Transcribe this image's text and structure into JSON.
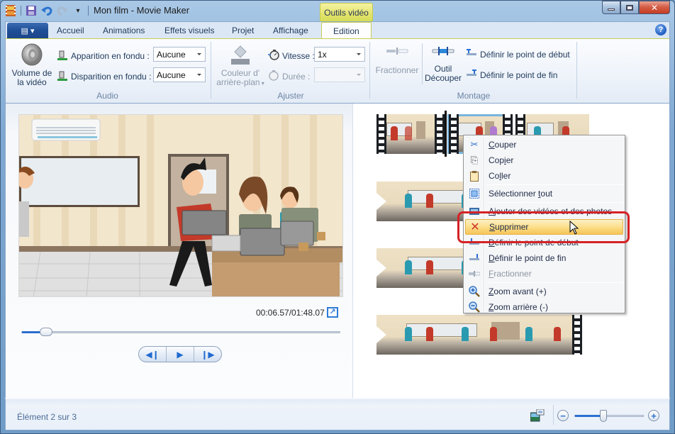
{
  "window": {
    "title": "Mon film - Movie Maker",
    "quick_access": [
      {
        "icon": "moviemaker-app-icon"
      },
      {
        "icon": "save-icon"
      },
      {
        "icon": "undo-icon"
      },
      {
        "icon": "redo-icon"
      },
      {
        "icon": "customize-qat-icon"
      }
    ],
    "controls": {
      "minimize": "—",
      "maximize": "▫",
      "close": "✕"
    }
  },
  "ribbon": {
    "app_menu_label": "▤ ▾",
    "contextual_header": "Outils vidéo",
    "tabs": [
      {
        "label": "Accueil",
        "active": false
      },
      {
        "label": "Animations",
        "active": false
      },
      {
        "label": "Effets visuels",
        "active": false
      },
      {
        "label": "Projet",
        "active": false
      },
      {
        "label": "Affichage",
        "active": false
      },
      {
        "label": "Edition",
        "active": true
      }
    ],
    "help_label": "?",
    "groups": {
      "audio": {
        "label": "Audio",
        "volume_label_1": "Volume de",
        "volume_label_2": "la vidéo",
        "fade_in_label": "Apparition en fondu :",
        "fade_in_value": "Aucune",
        "fade_out_label": "Disparition en fondu :",
        "fade_out_value": "Aucune"
      },
      "ajuster": {
        "label": "Ajuster",
        "bg_color_label_1": "Couleur d'",
        "bg_color_label_2": "arrière-plan",
        "speed_label": "Vitesse :",
        "speed_value": "1x",
        "duration_label": "Durée :",
        "duration_value": ""
      },
      "montage": {
        "label": "Montage",
        "split_label": "Fractionner",
        "trim_label_1": "Outil",
        "trim_label_2": "Découper",
        "set_start_label": "Définir le point de début",
        "set_end_label": "Définir le point de fin"
      }
    }
  },
  "preview": {
    "timecode": "00:06.57/01:48.07",
    "progress_fraction": 0.061,
    "fullscreen_icon": "↗",
    "transport": {
      "prev": "◀❙",
      "play": "▶",
      "next": "❙▶"
    }
  },
  "context_menu": {
    "items": [
      {
        "label_pre": "",
        "accel": "C",
        "label_post": "ouper",
        "icon": "✂",
        "icon_name": "scissors-icon",
        "disabled": false
      },
      {
        "label_pre": "Cop",
        "accel": "i",
        "label_post": "er",
        "icon": "⎘",
        "icon_name": "copy-icon",
        "disabled": false
      },
      {
        "label_pre": "Co",
        "accel": "l",
        "label_post": "ler",
        "icon": "📋",
        "icon_name": "paste-icon",
        "disabled": false
      },
      {
        "separator": true
      },
      {
        "label_pre": "Sélectionner ",
        "accel": "t",
        "label_post": "out",
        "icon": "▣",
        "icon_name": "select-all-icon",
        "disabled": false
      },
      {
        "separator": true
      },
      {
        "label_pre": "",
        "accel": "A",
        "label_post": "jouter des vidéos et des photos",
        "icon": "🖼",
        "icon_name": "add-media-icon",
        "disabled": false
      },
      {
        "label_pre": "",
        "accel": "S",
        "label_post": "upprimer",
        "icon": "✕",
        "icon_name": "delete-icon",
        "disabled": false,
        "hover": true
      },
      {
        "label_pre": "",
        "accel": "D",
        "label_post": "éfinir le point de début",
        "icon": "⊥",
        "icon_name": "set-start-icon",
        "disabled": false
      },
      {
        "label_pre": "",
        "accel": "D",
        "label_post": "éfinir le point de fin",
        "icon": "⊥",
        "icon_name": "set-end-icon",
        "disabled": false
      },
      {
        "label_pre": "",
        "accel": "F",
        "label_post": "ractionner",
        "icon": "═",
        "icon_name": "split-icon",
        "disabled": true
      },
      {
        "separator": true
      },
      {
        "label_pre": "",
        "accel": "Z",
        "label_post": "oom avant (+)",
        "icon": "⊕",
        "icon_name": "zoom-in-icon",
        "disabled": false
      },
      {
        "label_pre": "",
        "accel": "Z",
        "label_post": "oom arrière (-)",
        "icon": "⊖",
        "icon_name": "zoom-out-icon",
        "disabled": false
      }
    ]
  },
  "status": {
    "text": "Élément 2 sur 3",
    "zoom_fraction": 0.42,
    "zoom_out": "−",
    "zoom_in": "+"
  }
}
